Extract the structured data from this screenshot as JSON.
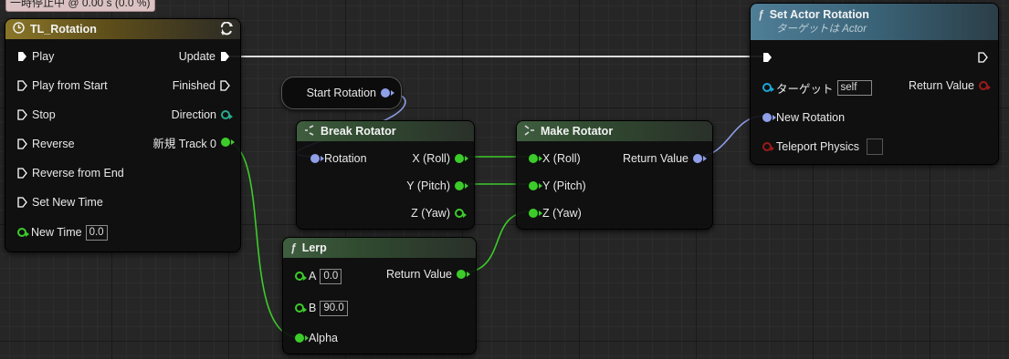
{
  "tooltip": "一時停止中 @ 0.00 s (0.0 %)",
  "colors": {
    "exec": "#ffffff",
    "float": "#3ccc2a",
    "rotator": "#8f9fe8",
    "bool": "#9b1a1a",
    "object": "#1ea6d8",
    "direction_enum": "#2aa88c"
  },
  "timeline": {
    "title": "TL_Rotation",
    "title_icon": "clock-icon",
    "header_action_icon": "loop-icon",
    "inputs": [
      {
        "label": "Play"
      },
      {
        "label": "Play from Start"
      },
      {
        "label": "Stop"
      },
      {
        "label": "Reverse"
      },
      {
        "label": "Reverse from End"
      },
      {
        "label": "Set New Time"
      }
    ],
    "new_time": {
      "label": "New Time",
      "value": "0.0"
    },
    "outputs": {
      "update": "Update",
      "finished": "Finished",
      "direction": "Direction",
      "track": "新規 Track 0"
    }
  },
  "start_rotation": {
    "label": "Start Rotation"
  },
  "break_rotator": {
    "title": "Break Rotator",
    "input": "Rotation",
    "outputs": [
      "X (Roll)",
      "Y (Pitch)",
      "Z (Yaw)"
    ]
  },
  "make_rotator": {
    "title": "Make Rotator",
    "inputs": [
      "X (Roll)",
      "Y (Pitch)",
      "Z (Yaw)"
    ],
    "output": "Return Value"
  },
  "lerp": {
    "title": "Lerp",
    "title_icon": "function-icon",
    "a": {
      "label": "A",
      "value": "0.0"
    },
    "b": {
      "label": "B",
      "value": "90.0"
    },
    "alpha": "Alpha",
    "output": "Return Value"
  },
  "set_actor_rotation": {
    "title": "Set Actor Rotation",
    "subtitle": "ターゲットは Actor",
    "title_icon": "function-icon",
    "target": {
      "label": "ターゲット",
      "value": "self"
    },
    "new_rotation": "New Rotation",
    "teleport": "Teleport Physics",
    "output": "Return Value"
  }
}
